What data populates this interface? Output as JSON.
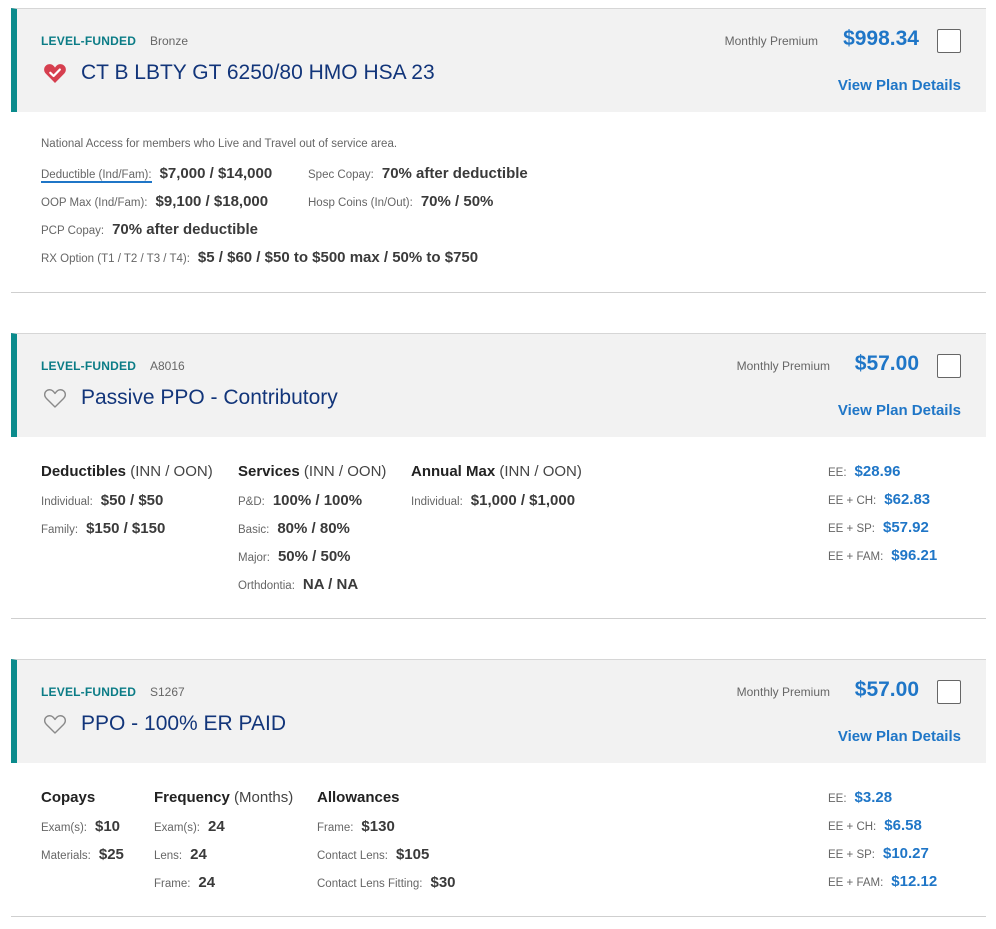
{
  "plans": [
    {
      "tier": "LEVEL-FUNDED",
      "code": "Bronze",
      "name": "CT B LBTY GT 6250/80 HMO HSA 23",
      "favorited": true,
      "premium_label": "Monthly Premium",
      "premium": "$998.34",
      "details_link": "View Plan Details",
      "note": "National Access for members who Live and Travel out of service area.",
      "benefits": [
        {
          "label": "Deductible (Ind/Fam):",
          "value": "$7,000 / $14,000"
        },
        {
          "label": "Spec Copay:",
          "value": "70% after deductible"
        },
        {
          "label": "OOP Max (Ind/Fam):",
          "value": "$9,100 / $18,000"
        },
        {
          "label": "Hosp Coins (In/Out):",
          "value": "70% / 50%"
        },
        {
          "label": "PCP Copay:",
          "value": "70% after deductible"
        },
        {
          "label": "RX Option (T1 / T2 / T3 / T4):",
          "value": "$5 / $60 / $50 to $500 max / 50% to $750"
        }
      ]
    },
    {
      "tier": "LEVEL-FUNDED",
      "code": "A8016",
      "name": "Passive PPO - Contributory",
      "favorited": false,
      "premium_label": "Monthly Premium",
      "premium": "$57.00",
      "details_link": "View Plan Details",
      "columns": [
        {
          "title": "Deductibles",
          "subtitle": "(INN / OON)",
          "rows": [
            {
              "label": "Individual:",
              "value": "$50 / $50"
            },
            {
              "label": "Family:",
              "value": "$150 / $150"
            }
          ]
        },
        {
          "title": "Services",
          "subtitle": "(INN / OON)",
          "rows": [
            {
              "label": "P&D:",
              "value": "100% / 100%"
            },
            {
              "label": "Basic:",
              "value": "80% / 80%"
            },
            {
              "label": "Major:",
              "value": "50% / 50%"
            },
            {
              "label": "Orthdontia:",
              "value": "NA / NA"
            }
          ]
        },
        {
          "title": "Annual Max",
          "subtitle": "(INN / OON)",
          "rows": [
            {
              "label": "Individual:",
              "value": "$1,000 / $1,000"
            }
          ]
        }
      ],
      "rates": [
        {
          "label": "EE:",
          "value": "$28.96"
        },
        {
          "label": "EE + CH:",
          "value": "$62.83"
        },
        {
          "label": "EE + SP:",
          "value": "$57.92"
        },
        {
          "label": "EE + FAM:",
          "value": "$96.21"
        }
      ]
    },
    {
      "tier": "LEVEL-FUNDED",
      "code": "S1267",
      "name": "PPO - 100% ER PAID",
      "favorited": false,
      "premium_label": "Monthly Premium",
      "premium": "$57.00",
      "details_link": "View Plan Details",
      "columns": [
        {
          "title": "Copays",
          "subtitle": "",
          "rows": [
            {
              "label": "Exam(s):",
              "value": "$10"
            },
            {
              "label": "Materials:",
              "value": "$25"
            }
          ]
        },
        {
          "title": "Frequency",
          "subtitle": "(Months)",
          "rows": [
            {
              "label": "Exam(s):",
              "value": "24"
            },
            {
              "label": "Lens:",
              "value": "24"
            },
            {
              "label": "Frame:",
              "value": "24"
            }
          ]
        },
        {
          "title": "Allowances",
          "subtitle": "",
          "rows": [
            {
              "label": "Frame:",
              "value": "$130"
            },
            {
              "label": "Contact Lens:",
              "value": "$105"
            },
            {
              "label": "Contact Lens Fitting:",
              "value": "$30"
            }
          ]
        }
      ],
      "rates": [
        {
          "label": "EE:",
          "value": "$3.28"
        },
        {
          "label": "EE + CH:",
          "value": "$6.58"
        },
        {
          "label": "EE + SP:",
          "value": "$10.27"
        },
        {
          "label": "EE + FAM:",
          "value": "$12.12"
        }
      ]
    }
  ],
  "colors": {
    "accent_teal": "#0b8b8c",
    "link_blue": "#1f76c7",
    "title_navy": "#12357a",
    "favorite_red": "#d63f4f"
  },
  "icons": {
    "favorite_filled": "heart-filled-icon",
    "favorite_empty": "heart-outline-icon"
  }
}
